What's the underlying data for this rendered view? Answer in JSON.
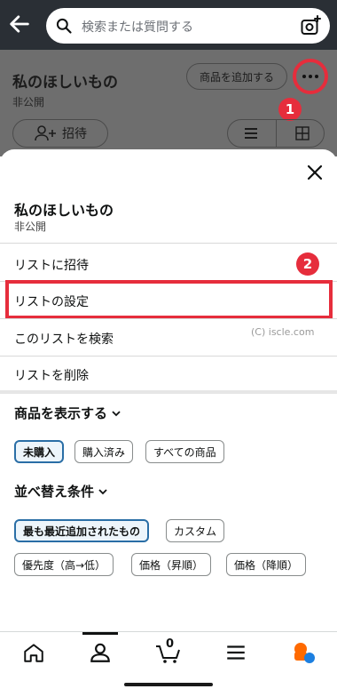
{
  "header": {
    "search_placeholder": "検索または質問する"
  },
  "background_page": {
    "list_title": "私のほしいもの",
    "list_visibility": "非公開",
    "add_item_label": "商品を追加する",
    "invite_label": "招待",
    "annotation_1": "1"
  },
  "sheet": {
    "title": "私のほしいもの",
    "visibility": "非公開",
    "menu": [
      {
        "label": "リストに招待"
      },
      {
        "label": "リストの設定"
      },
      {
        "label": "このリストを検索"
      },
      {
        "label": "リストを削除"
      }
    ],
    "annotation_2": "2",
    "watermark": "(C) iscle.com",
    "show_items": {
      "heading": "商品を表示する",
      "options": [
        {
          "label": "未購入",
          "selected": true
        },
        {
          "label": "購入済み",
          "selected": false
        },
        {
          "label": "すべての商品",
          "selected": false
        }
      ]
    },
    "sort": {
      "heading": "並べ替え条件",
      "options": [
        {
          "label": "最も最近追加されたもの",
          "selected": true
        },
        {
          "label": "カスタム",
          "selected": false
        },
        {
          "label": "優先度（高→低）",
          "selected": false
        },
        {
          "label": "価格（昇順）",
          "selected": false
        },
        {
          "label": "価格（降順）",
          "selected": false
        }
      ]
    }
  },
  "bottom_nav": {
    "cart_count": "0"
  },
  "colors": {
    "annotation_red": "#e62d3c",
    "selected_chip_border": "#2a6ea6",
    "header_bg": "#2a2f35"
  }
}
